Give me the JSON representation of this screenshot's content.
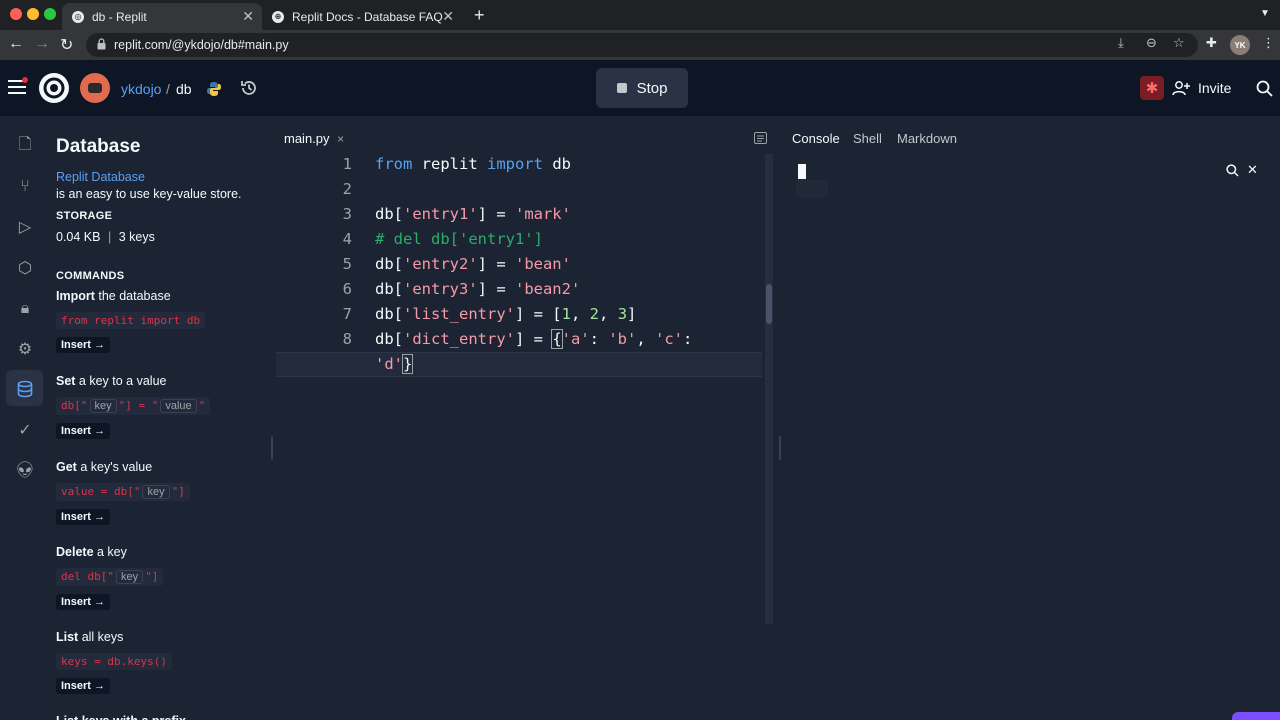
{
  "browser": {
    "tabs": [
      {
        "title": "db - Replit",
        "active": true
      },
      {
        "title": "Replit Docs - Database FAQ",
        "active": false
      }
    ],
    "new_tab_icon": "+",
    "url": "replit.com/@ykdojo/db#main.py",
    "profile_initials": "YK"
  },
  "header": {
    "username": "ykdojo",
    "separator": "/",
    "repl_name": "db",
    "stop_label": "Stop",
    "invite_label": "Invite"
  },
  "database": {
    "title": "Database",
    "link_text": "Replit Database",
    "description": "is an easy to use key-value store.",
    "storage_label": "STORAGE",
    "storage_size": "0.04 KB",
    "storage_sep": "|",
    "storage_keys": "3 keys",
    "commands_label": "COMMANDS",
    "insert_label": "Insert →",
    "commands": [
      {
        "bold": "Import",
        "rest": " the database",
        "code_pre": "from replit import db",
        "ph1": "",
        "mid": "",
        "ph2": "",
        "code_post": ""
      },
      {
        "bold": "Set",
        "rest": " a key to a value",
        "code_pre": "db[\"",
        "ph1": "key",
        "mid": "\"] = \"",
        "ph2": "value",
        "code_post": "\""
      },
      {
        "bold": "Get",
        "rest": " a key's value",
        "code_pre": "value = db[\"",
        "ph1": "key",
        "mid": "\"]",
        "ph2": "",
        "code_post": ""
      },
      {
        "bold": "Delete",
        "rest": " a key",
        "code_pre": "del db[\"",
        "ph1": "key",
        "mid": "\"]",
        "ph2": "",
        "code_post": ""
      },
      {
        "bold": "List",
        "rest": " all keys",
        "code_pre": "keys = db.keys()",
        "ph1": "",
        "mid": "",
        "ph2": "",
        "code_post": ""
      }
    ],
    "cutoff_text": "List keys with a prefix"
  },
  "editor": {
    "file_tab": "main.py",
    "close_icon": "×",
    "line_numbers": [
      "1",
      "2",
      "3",
      "4",
      "5",
      "6",
      "7",
      "8"
    ]
  },
  "console": {
    "tabs": [
      "Console",
      "Shell",
      "Markdown"
    ]
  }
}
